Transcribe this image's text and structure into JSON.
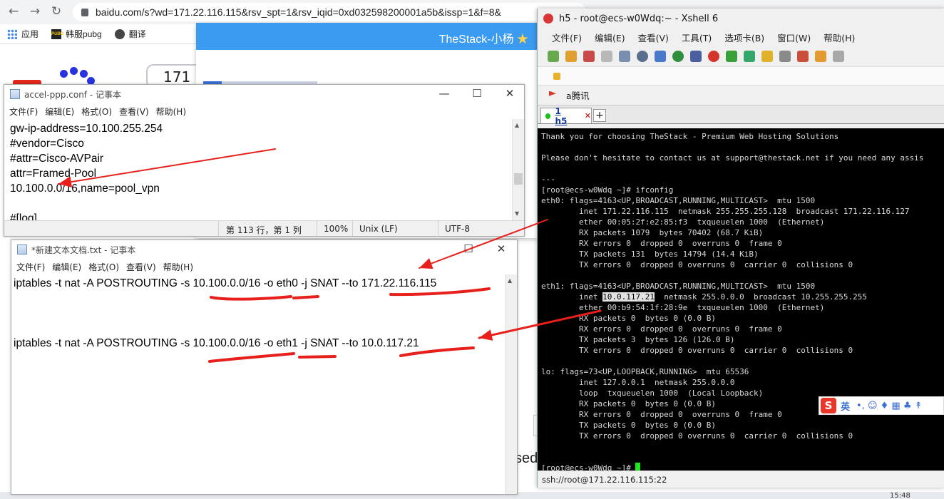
{
  "browser": {
    "url": "baidu.com/s?wd=171.22.116.115&rsv_spt=1&rsv_iqid=0xd032598200001a5b&issp=1&f=8&",
    "bookmarks": [
      "应用",
      "韩服pubg",
      "翻译"
    ],
    "search_fragment": "171",
    "bottom_fragment": "sed",
    "tray_time": "15:48"
  },
  "popup": {
    "title": "TheStack-小杨",
    "star": "★"
  },
  "notepad1": {
    "title": "accel-ppp.conf - 记事本",
    "menu": [
      "文件(F)",
      "编辑(E)",
      "格式(O)",
      "查看(V)",
      "帮助(H)"
    ],
    "lines": [
      "gw-ip-address=10.100.255.254",
      "#vendor=Cisco",
      "#attr=Cisco-AVPair",
      "attr=Framed-Pool",
      "10.100.0.0/16,name=pool_vpn",
      "",
      "#[log]"
    ],
    "status": {
      "position": "第 113 行，第 1 列",
      "zoom": "100%",
      "eol": "Unix (LF)",
      "encoding": "UTF-8"
    }
  },
  "notepad2": {
    "title": "*新建文本文档.txt - 记事本",
    "menu": [
      "文件(F)",
      "编辑(E)",
      "格式(O)",
      "查看(V)",
      "帮助(H)"
    ],
    "lines": [
      "iptables -t nat -A POSTROUTING -s 10.100.0.0/16 -o eth0 -j SNAT --to 171.22.116.115",
      "",
      "",
      "",
      "iptables -t nat -A POSTROUTING -s 10.100.0.0/16 -o eth1 -j SNAT --to 10.0.117.21"
    ]
  },
  "xshell": {
    "title": "h5 - root@ecs-w0Wdq:~ - Xshell 6",
    "menu": [
      "文件(F)",
      "编辑(E)",
      "查看(V)",
      "工具(T)",
      "选项卡(B)",
      "窗口(W)",
      "帮助(H)"
    ],
    "link": "a腾讯",
    "tab": {
      "label": "1 h5",
      "close": "✕"
    },
    "plus": "+",
    "status": "ssh://root@171.22.116.115:22",
    "terminal": [
      "Thank you for choosing TheStack - Premium Web Hosting Solutions",
      "",
      "Please don't hesitate to contact us at support@thestack.net if you need any assis",
      "",
      "---",
      "[root@ecs-w0Wdq ~]# ifconfig",
      "eth0: flags=4163<UP,BROADCAST,RUNNING,MULTICAST>  mtu 1500",
      "        inet 171.22.116.115  netmask 255.255.255.128  broadcast 171.22.116.127",
      "        ether 00:05:2f:e2:85:f3  txqueuelen 1000  (Ethernet)",
      "        RX packets 1079  bytes 70402 (68.7 KiB)",
      "        RX errors 0  dropped 0  overruns 0  frame 0",
      "        TX packets 131  bytes 14794 (14.4 KiB)",
      "        TX errors 0  dropped 0 overruns 0  carrier 0  collisions 0",
      "",
      "eth1: flags=4163<UP,BROADCAST,RUNNING,MULTICAST>  mtu 1500",
      "        inet ",
      "        ether 00:b9:54:1f:28:9e  txqueuelen 1000  (Ethernet)",
      "        RX packets 0  bytes 0 (0.0 B)",
      "        RX errors 0  dropped 0  overruns 0  frame 0",
      "        TX packets 3  bytes 126 (126.0 B)",
      "        TX errors 0  dropped 0 overruns 0  carrier 0  collisions 0",
      "",
      "lo: flags=73<UP,LOOPBACK,RUNNING>  mtu 65536",
      "        inet 127.0.0.1  netmask 255.0.0.0",
      "        loop  txqueuelen 1000  (Local Loopback)",
      "        RX packets 0  bytes 0 (0.0 B)",
      "        RX errors 0  dropped 0  overruns 0  frame 0",
      "        TX packets 0  bytes 0 (0.0 B)",
      "        TX errors 0  dropped 0 overruns 0  carrier 0  collisions 0",
      "",
      "",
      "[root@ecs-w0Wdq ~]# "
    ],
    "eth1_ip": "10.0.117.21",
    "eth1_rest": "  netmask 255.0.0.0  broadcast 10.255.255.255"
  },
  "ime": {
    "logo": "S",
    "mode": "英",
    "icons": "•, ☺ ♦ ▦ ♣ ↟"
  },
  "colors": {
    "annotation": "#e8201c",
    "terminal_bg": "#000000",
    "popup_header": "#3a9bf0",
    "cursor": "#1fe51f"
  }
}
